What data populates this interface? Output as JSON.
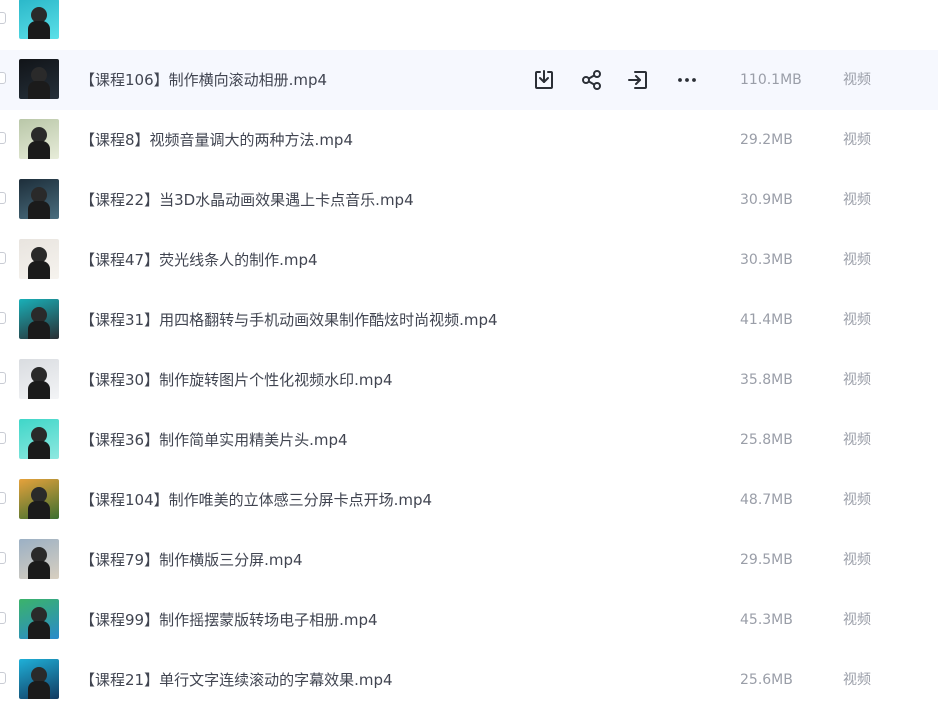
{
  "files": [
    {
      "name": "",
      "size": "",
      "type": "",
      "thumb": [
        "#2ab7c9",
        "#5ce0e8"
      ]
    },
    {
      "name": "【课程106】制作横向滚动相册.mp4",
      "size": "110.1MB",
      "type": "视频",
      "thumb": [
        "#111418",
        "#25303a"
      ],
      "hover": true
    },
    {
      "name": "【课程8】视频音量调大的两种方法.mp4",
      "size": "29.2MB",
      "type": "视频",
      "thumb": [
        "#b9c7a8",
        "#e7ecd9"
      ]
    },
    {
      "name": "【课程22】当3D水晶动画效果遇上卡点音乐.mp4",
      "size": "30.9MB",
      "type": "视频",
      "thumb": [
        "#1d2e3a",
        "#4a6d7e"
      ]
    },
    {
      "name": "【课程47】荧光线条人的制作.mp4",
      "size": "30.3MB",
      "type": "视频",
      "thumb": [
        "#e8e4df",
        "#f6f3ee"
      ]
    },
    {
      "name": "【课程31】用四格翻转与手机动画效果制作酷炫时尚视频.mp4",
      "size": "41.4MB",
      "type": "视频",
      "thumb": [
        "#19b0b8",
        "#2a2e33"
      ]
    },
    {
      "name": "【课程30】制作旋转图片个性化视频水印.mp4",
      "size": "35.8MB",
      "type": "视频",
      "thumb": [
        "#d9dce0",
        "#f3f4f6"
      ]
    },
    {
      "name": "【课程36】制作简单实用精美片头.mp4",
      "size": "25.8MB",
      "type": "视频",
      "thumb": [
        "#3fd6c8",
        "#8ee8e0"
      ]
    },
    {
      "name": "【课程104】制作唯美的立体感三分屏卡点开场.mp4",
      "size": "48.7MB",
      "type": "视频",
      "thumb": [
        "#e6a23c",
        "#3b6e2f"
      ]
    },
    {
      "name": "【课程79】制作横版三分屏.mp4",
      "size": "29.5MB",
      "type": "视频",
      "thumb": [
        "#9bb0c4",
        "#d8cfc0"
      ]
    },
    {
      "name": "【课程99】制作摇摆蒙版转场电子相册.mp4",
      "size": "45.3MB",
      "type": "视频",
      "thumb": [
        "#3bb36a",
        "#2a8acb"
      ]
    },
    {
      "name": "【课程21】单行文字连续滚动的字幕效果.mp4",
      "size": "25.6MB",
      "type": "视频",
      "thumb": [
        "#1fb0d8",
        "#123a60"
      ]
    }
  ],
  "actions": {
    "download": "download-icon",
    "share": "share-icon",
    "move": "move-to-icon",
    "more": "more-icon"
  },
  "colors": {
    "hover_bg": "#f6f8fe",
    "name_text": "#414551",
    "meta_text": "#9a9ea8"
  }
}
